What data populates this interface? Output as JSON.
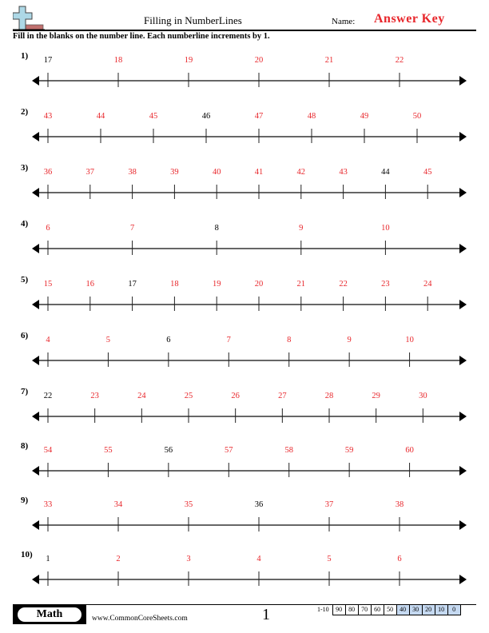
{
  "header": {
    "title": "Filling in NumberLines",
    "name_label": "Name:",
    "answer_key": "Answer Key",
    "logo_icon": "plus-ruler-logo-icon"
  },
  "instructions": "Fill in the blanks on the number line. Each numberline increments by 1.",
  "colors": {
    "answer": "#e8262b",
    "given": "#000000"
  },
  "problems": [
    {
      "label": "1)",
      "ticks": [
        "17",
        "18",
        "19",
        "20",
        "21",
        "22"
      ],
      "given_index": 0
    },
    {
      "label": "2)",
      "ticks": [
        "43",
        "44",
        "45",
        "46",
        "47",
        "48",
        "49",
        "50"
      ],
      "given_index": 3
    },
    {
      "label": "3)",
      "ticks": [
        "36",
        "37",
        "38",
        "39",
        "40",
        "41",
        "42",
        "43",
        "44",
        "45"
      ],
      "given_index": 8
    },
    {
      "label": "4)",
      "ticks": [
        "6",
        "7",
        "8",
        "9",
        "10"
      ],
      "given_index": 2
    },
    {
      "label": "5)",
      "ticks": [
        "15",
        "16",
        "17",
        "18",
        "19",
        "20",
        "21",
        "22",
        "23",
        "24"
      ],
      "given_index": 2
    },
    {
      "label": "6)",
      "ticks": [
        "4",
        "5",
        "6",
        "7",
        "8",
        "9",
        "10"
      ],
      "given_index": 2
    },
    {
      "label": "7)",
      "ticks": [
        "22",
        "23",
        "24",
        "25",
        "26",
        "27",
        "28",
        "29",
        "30"
      ],
      "given_index": 0
    },
    {
      "label": "8)",
      "ticks": [
        "54",
        "55",
        "56",
        "57",
        "58",
        "59",
        "60"
      ],
      "given_index": 2
    },
    {
      "label": "9)",
      "ticks": [
        "33",
        "34",
        "35",
        "36",
        "37",
        "38"
      ],
      "given_index": 3
    },
    {
      "label": "10)",
      "ticks": [
        "1",
        "2",
        "3",
        "4",
        "5",
        "6"
      ],
      "given_index": 0
    }
  ],
  "footer": {
    "subject": "Math",
    "site": "www.CommonCoreSheets.com",
    "page": "1",
    "score_label": "1-10",
    "scores": [
      "90",
      "80",
      "70",
      "60",
      "50",
      "40",
      "30",
      "20",
      "10",
      "0"
    ],
    "highlighted_from_index": 5
  }
}
